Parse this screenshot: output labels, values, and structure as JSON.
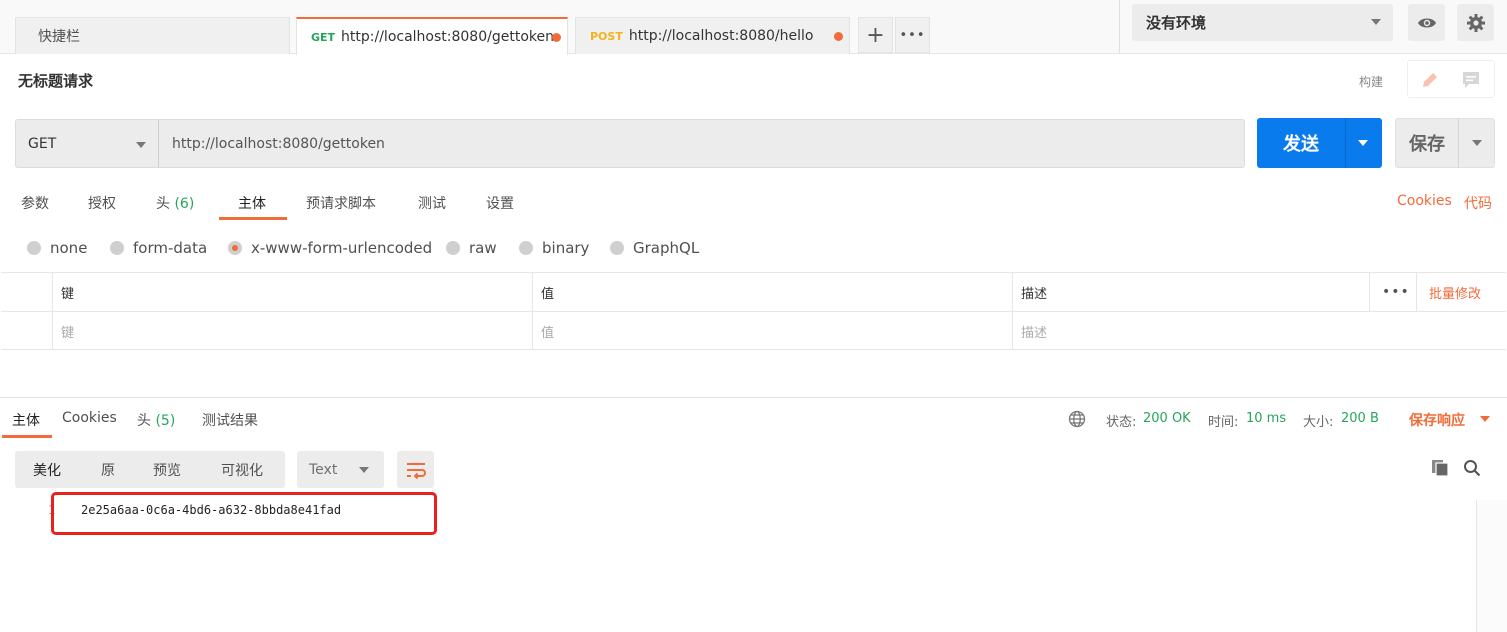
{
  "tabs": {
    "quickbar": "快捷栏",
    "items": [
      {
        "method": "GET",
        "method_color": "#26a65b",
        "url": "http://localhost:8080/gettoken",
        "active": true
      },
      {
        "method": "POST",
        "method_color": "#f2b31a",
        "url": "http://localhost:8080/hello",
        "active": false
      }
    ],
    "add_label": "+",
    "more_label": "•••"
  },
  "environment": {
    "selected": "没有环境"
  },
  "request": {
    "title": "无标题请求",
    "build_label": "构建",
    "method": "GET",
    "url": "http://localhost:8080/gettoken",
    "send_label": "发送",
    "save_label": "保存",
    "tabs": [
      {
        "label": "参数"
      },
      {
        "label": "授权"
      },
      {
        "label": "头",
        "count": "(6)"
      },
      {
        "label": "主体",
        "active": true
      },
      {
        "label": "预请求脚本"
      },
      {
        "label": "测试"
      },
      {
        "label": "设置"
      }
    ],
    "cookies_link": "Cookies",
    "code_link": "代码",
    "body_types": [
      {
        "label": "none",
        "selected": false
      },
      {
        "label": "form-data",
        "selected": false
      },
      {
        "label": "x-www-form-urlencoded",
        "selected": true
      },
      {
        "label": "raw",
        "selected": false
      },
      {
        "label": "binary",
        "selected": false
      },
      {
        "label": "GraphQL",
        "selected": false
      }
    ],
    "kv_table": {
      "headers": [
        "键",
        "值",
        "描述"
      ],
      "placeholders": [
        "键",
        "值",
        "描述"
      ],
      "more": "•••",
      "bulk_edit": "批量修改"
    }
  },
  "response": {
    "tabs": [
      {
        "label": "主体",
        "active": true
      },
      {
        "label": "Cookies"
      },
      {
        "label": "头",
        "count": "(5)"
      },
      {
        "label": "测试结果"
      }
    ],
    "status_label": "状态:",
    "status_value": "200 OK",
    "time_label": "时间:",
    "time_value": "10 ms",
    "size_label": "大小:",
    "size_value": "200 B",
    "save_response": "保存响应",
    "view_modes": [
      "美化",
      "原",
      "预览",
      "可视化"
    ],
    "selected_view": "美化",
    "format": "Text",
    "lines": [
      {
        "no": "1",
        "text": "2e25a6aa-0c6a-4bd6-a632-8bbda8e41fad"
      }
    ]
  },
  "colors": {
    "accent": "#f26b3a",
    "send": "#097bed",
    "success": "#26a65b",
    "highlight": "#e8211c"
  },
  "icons": [
    "eye-icon",
    "gear-icon",
    "pencil-icon",
    "comment-icon",
    "globe-icon",
    "wrap-icon",
    "copy-icon",
    "search-icon"
  ]
}
